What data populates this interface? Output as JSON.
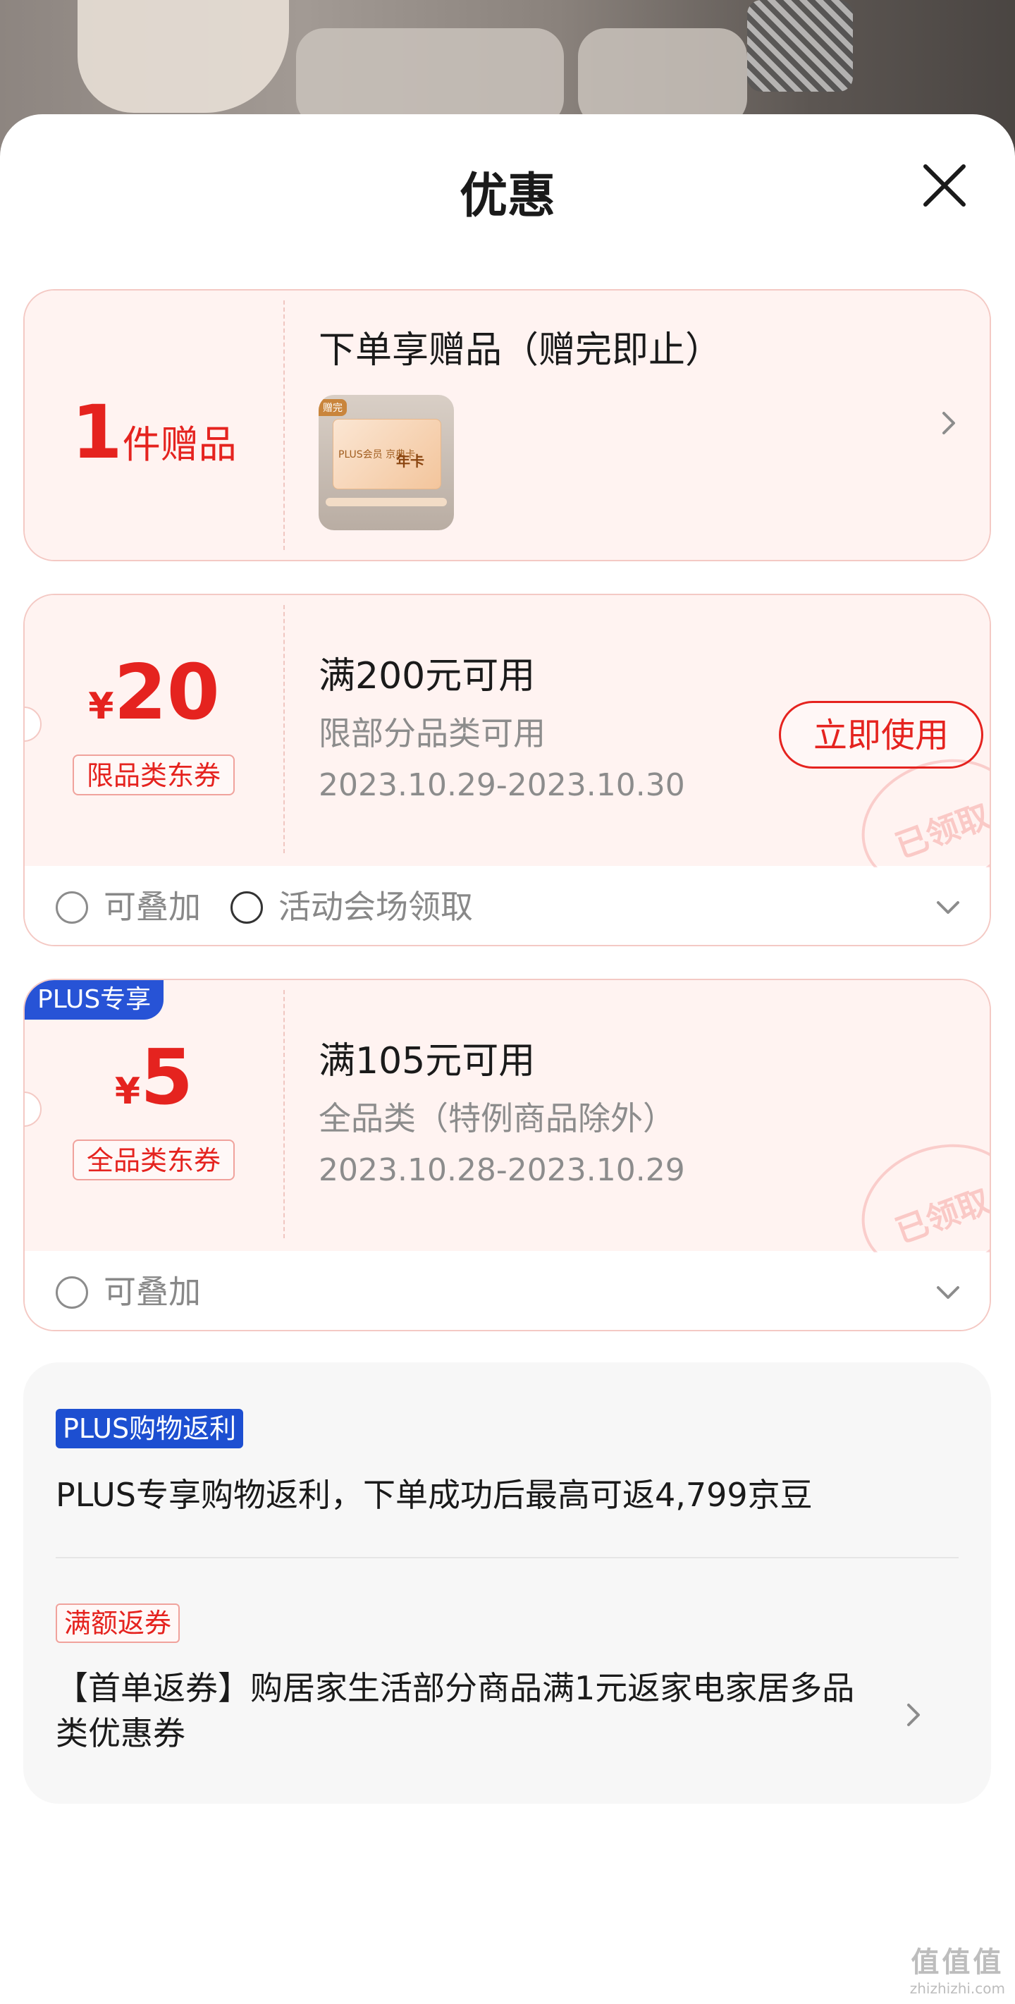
{
  "sheet": {
    "title": "优惠"
  },
  "gift_card": {
    "count": "1",
    "unit": "件赠品",
    "title": "下单享赠品（赠完即止）",
    "thumb": {
      "tag": "赠完",
      "line": "PLUS会员 京典卡",
      "label": "年卡"
    }
  },
  "coupon1": {
    "currency": "¥",
    "amount": "20",
    "type_tag": "限品类东券",
    "title": "满200元可用",
    "scope": "限部分品类可用",
    "date": "2023.10.29-2023.10.30",
    "use_button": "立即使用",
    "stamp": "已领取",
    "foot": {
      "stackable": "可叠加",
      "source": "活动会场领取"
    }
  },
  "coupon2": {
    "badge": "PLUS专享",
    "currency": "¥",
    "amount": "5",
    "type_tag": "全品类东券",
    "title": "满105元可用",
    "scope": "全品类（特例商品除外）",
    "date": "2023.10.28-2023.10.29",
    "stamp": "已领取",
    "foot": {
      "stackable": "可叠加"
    }
  },
  "rebate": {
    "plus_tag": "PLUS购物返利",
    "plus_text": "PLUS专享购物返利，下单成功后最高可返4,799京豆",
    "full_tag": "满额返券",
    "full_text": "【首单返券】购居家生活部分商品满1元返家电家居多品类优惠券"
  },
  "watermark": {
    "logo": "值值值",
    "site": "zhizhizhi.com"
  },
  "colors": {
    "accent": "#e5231f",
    "plus_blue": "#2753d6",
    "card_bg": "#fff3f1"
  }
}
